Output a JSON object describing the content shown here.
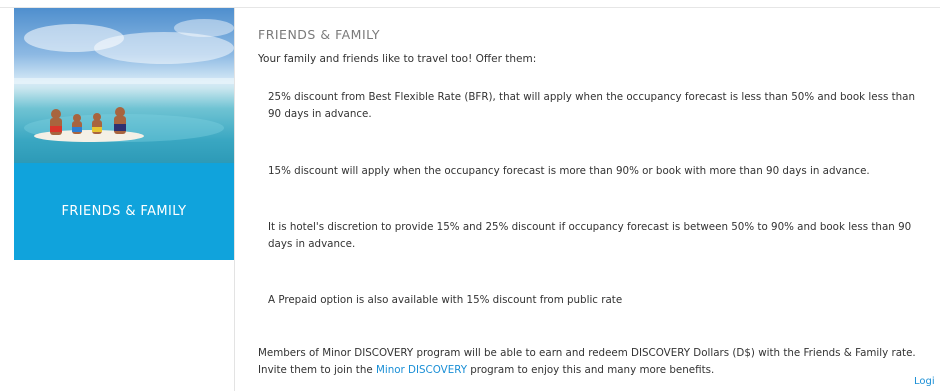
{
  "card": {
    "banner_label": "FRIENDS & FAMILY"
  },
  "main": {
    "title": "FRIENDS & FAMILY",
    "intro": "Your family and friends like to travel too! Offer them:",
    "offers": [
      "25% discount from Best Flexible Rate (BFR), that will apply when the occupancy forecast is less than 50% and book less than 90 days in advance.",
      "15% discount will apply when the occupancy forecast is more than 90% or book with more than 90 days in advance.",
      "It is hotel's discretion to provide 15% and 25% discount if occupancy forecast is between 50% to 90% and book less than 90 days in advance.",
      "A Prepaid option is also available with 15% discount from public rate"
    ],
    "members_text_before": "Members of Minor DISCOVERY program will be able to earn and redeem DISCOVERY Dollars (D$) with the Friends & Family rate. Invite them to join the ",
    "members_link": "Minor DISCOVERY",
    "members_text_after": " program to enjoy this and many more benefits."
  },
  "login_label": "Logi",
  "colors": {
    "banner": "#10a3dc",
    "link": "#1a8fd6",
    "title": "#7a7a7a"
  }
}
